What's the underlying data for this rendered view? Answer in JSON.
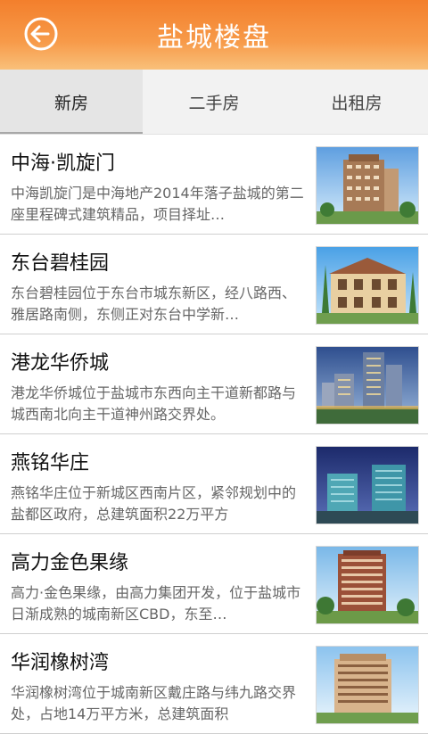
{
  "header": {
    "title": "盐城楼盘",
    "back_icon": "back-arrow-icon"
  },
  "tabs": [
    {
      "label": "新房",
      "active": true
    },
    {
      "label": "二手房",
      "active": false
    },
    {
      "label": "出租房",
      "active": false
    }
  ],
  "listings": [
    {
      "title": "中海·凯旋门",
      "desc": "中海凯旋门是中海地产2014年落子盐城的第二座里程碑式建筑精品，项目择址…"
    },
    {
      "title": "东台碧桂园",
      "desc": "东台碧桂园位于东台市城东新区，经八路西、雅居路南侧，东侧正对东台中学新…"
    },
    {
      "title": "港龙华侨城",
      "desc": "港龙华侨城位于盐城市东西向主干道新都路与城西南北向主干道神州路交界处。"
    },
    {
      "title": "燕铭华庄",
      "desc": "燕铭华庄位于新城区西南片区，紧邻规划中的盐都区政府，总建筑面积22万平方"
    },
    {
      "title": "高力金色果缘",
      "desc": "高力·金色果缘，由高力集团开发，位于盐城市日渐成熟的城南新区CBD，东至…"
    },
    {
      "title": "华润橡树湾",
      "desc": "华润橡树湾位于城南新区戴庄路与纬九路交界处，占地14万平方米，总建筑面积"
    }
  ],
  "colors": {
    "header_top": "#f37f2c",
    "header_bottom": "#f9c07a"
  }
}
